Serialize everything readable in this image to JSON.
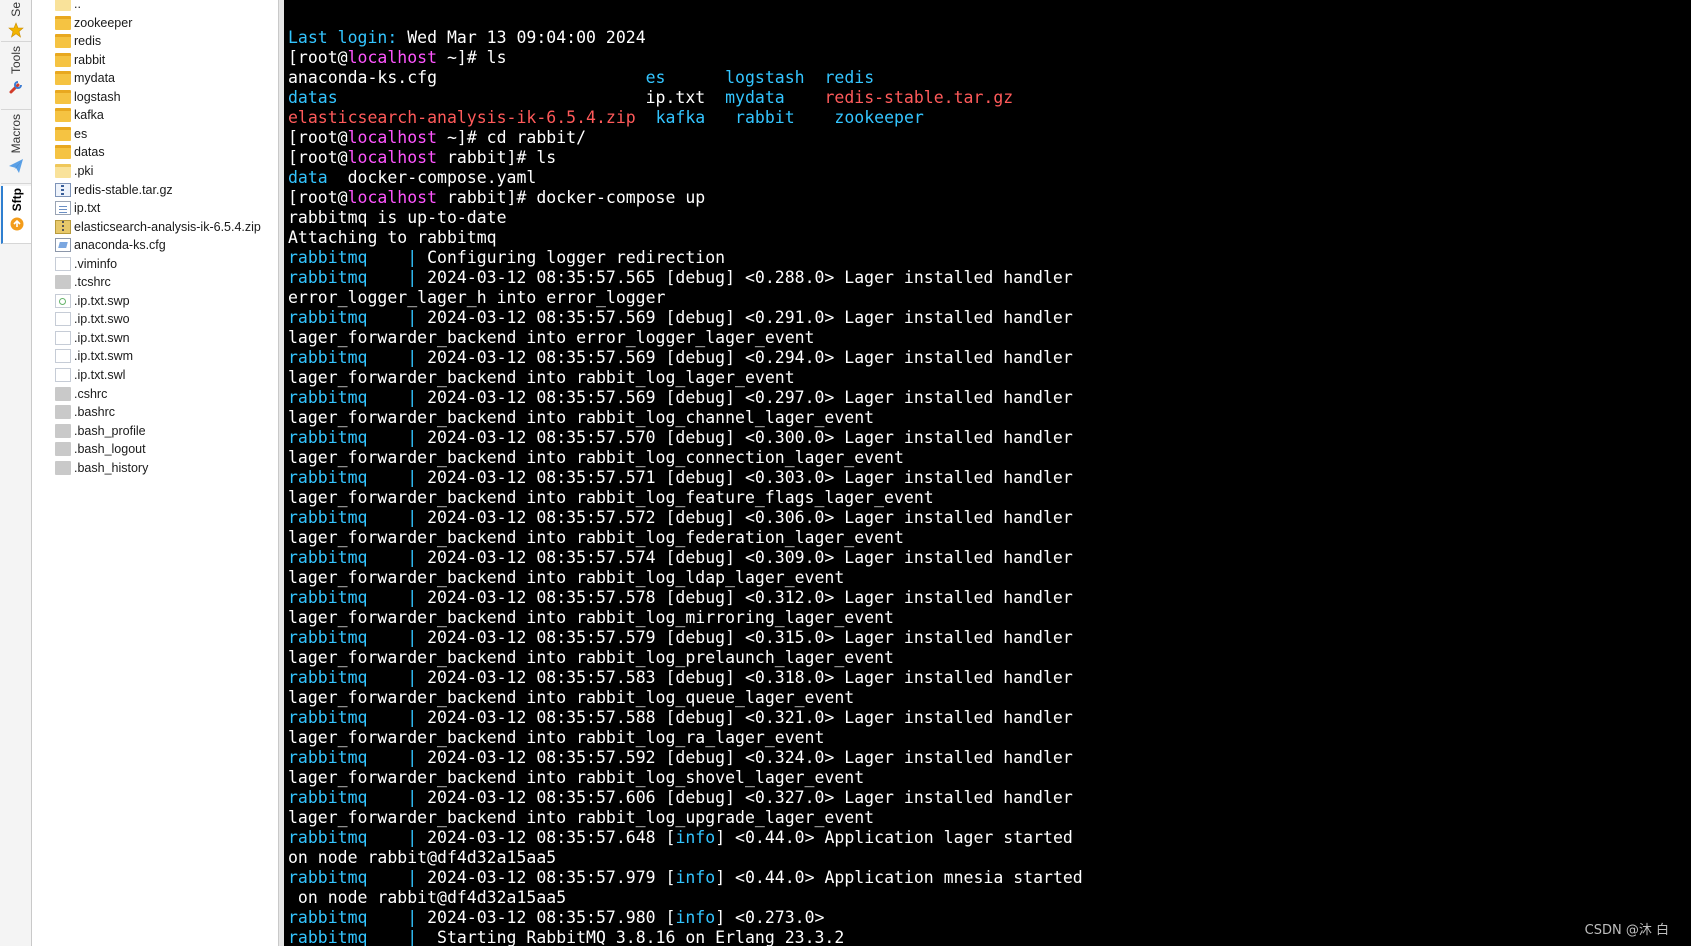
{
  "colors": {
    "prompt_host": "#ff55ff",
    "service": "#33c5ff",
    "folder": "#33c5ff",
    "info": "#33c5ff",
    "archive": "#ff5a5a",
    "text": "#ffffff",
    "background": "#000000"
  },
  "side_tabs": [
    {
      "label": "Se",
      "icon": "star-icon",
      "active": false
    },
    {
      "label": "Tools",
      "icon": "tools-icon",
      "active": false
    },
    {
      "label": "Macros",
      "icon": "macros-icon",
      "active": false
    },
    {
      "label": "Sftp",
      "icon": "sftp-icon",
      "active": true
    }
  ],
  "files": [
    {
      "name": "..",
      "icon": "parent-folder-icon"
    },
    {
      "name": "zookeeper",
      "icon": "folder-icon"
    },
    {
      "name": "redis",
      "icon": "folder-icon"
    },
    {
      "name": "rabbit",
      "icon": "folder-icon"
    },
    {
      "name": "mydata",
      "icon": "folder-icon"
    },
    {
      "name": "logstash",
      "icon": "folder-icon"
    },
    {
      "name": "kafka",
      "icon": "folder-icon"
    },
    {
      "name": "es",
      "icon": "folder-icon"
    },
    {
      "name": "datas",
      "icon": "folder-icon"
    },
    {
      "name": ".pki",
      "icon": "hidden-folder-icon"
    },
    {
      "name": "redis-stable.tar.gz",
      "icon": "archive-file-icon"
    },
    {
      "name": "ip.txt",
      "icon": "text-file-icon"
    },
    {
      "name": "elasticsearch-analysis-ik-6.5.4.zip",
      "icon": "zip-file-icon"
    },
    {
      "name": "anaconda-ks.cfg",
      "icon": "config-file-icon"
    },
    {
      "name": ".viminfo",
      "icon": "file-icon"
    },
    {
      "name": ".tcshrc",
      "icon": "hidden-file-icon"
    },
    {
      "name": ".ip.txt.swp",
      "icon": "swap-file-icon"
    },
    {
      "name": ".ip.txt.swo",
      "icon": "file-icon"
    },
    {
      "name": ".ip.txt.swn",
      "icon": "file-icon"
    },
    {
      "name": ".ip.txt.swm",
      "icon": "file-icon"
    },
    {
      "name": ".ip.txt.swl",
      "icon": "file-icon"
    },
    {
      "name": ".cshrc",
      "icon": "hidden-file-icon"
    },
    {
      "name": ".bashrc",
      "icon": "hidden-file-icon"
    },
    {
      "name": ".bash_profile",
      "icon": "hidden-file-icon"
    },
    {
      "name": ".bash_logout",
      "icon": "hidden-file-icon"
    },
    {
      "name": ".bash_history",
      "icon": "hidden-file-icon"
    }
  ],
  "terminal": {
    "lines": [
      [
        {
          "t": "Last login:",
          "c": "service"
        },
        {
          "t": " Wed Mar 13 09:04:00 2024"
        }
      ],
      [
        {
          "t": "[root@"
        },
        {
          "t": "localhost",
          "c": "prompt_host"
        },
        {
          "t": " ~]# ls"
        }
      ],
      [
        {
          "t": "anaconda-ks.cfg                     "
        },
        {
          "t": "es",
          "c": "folder"
        },
        {
          "t": "      "
        },
        {
          "t": "logstash",
          "c": "folder"
        },
        {
          "t": "  "
        },
        {
          "t": "redis",
          "c": "folder"
        }
      ],
      [
        {
          "t": "datas",
          "c": "folder"
        },
        {
          "t": "                               ip.txt  "
        },
        {
          "t": "mydata",
          "c": "folder"
        },
        {
          "t": "    "
        },
        {
          "t": "redis-stable.tar.gz",
          "c": "archive"
        }
      ],
      [
        {
          "t": "elasticsearch-analysis-ik-6.5.4.zip",
          "c": "archive"
        },
        {
          "t": "  "
        },
        {
          "t": "kafka",
          "c": "folder"
        },
        {
          "t": "   "
        },
        {
          "t": "rabbit",
          "c": "folder"
        },
        {
          "t": "    "
        },
        {
          "t": "zookeeper",
          "c": "folder"
        }
      ],
      [
        {
          "t": "[root@"
        },
        {
          "t": "localhost",
          "c": "prompt_host"
        },
        {
          "t": " ~]# cd rabbit/"
        }
      ],
      [
        {
          "t": "[root@"
        },
        {
          "t": "localhost",
          "c": "prompt_host"
        },
        {
          "t": " rabbit]# ls"
        }
      ],
      [
        {
          "t": "data",
          "c": "folder"
        },
        {
          "t": "  docker-compose.yaml"
        }
      ],
      [
        {
          "t": "[root@"
        },
        {
          "t": "localhost",
          "c": "prompt_host"
        },
        {
          "t": " rabbit]# docker-compose up"
        }
      ],
      [
        {
          "t": "rabbitmq is up-to-date"
        }
      ],
      [
        {
          "t": "Attaching to rabbitmq"
        }
      ],
      [
        {
          "t": "rabbitmq    | ",
          "c": "service"
        },
        {
          "t": "Configuring logger redirection"
        }
      ],
      [
        {
          "t": "rabbitmq    | ",
          "c": "service"
        },
        {
          "t": "2024-03-12 08:35:57.565 [debug] <0.288.0> Lager installed handler"
        }
      ],
      [
        {
          "t": "error_logger_lager_h into error_logger"
        }
      ],
      [
        {
          "t": "rabbitmq    | ",
          "c": "service"
        },
        {
          "t": "2024-03-12 08:35:57.569 [debug] <0.291.0> Lager installed handler"
        }
      ],
      [
        {
          "t": "lager_forwarder_backend into error_logger_lager_event"
        }
      ],
      [
        {
          "t": "rabbitmq    | ",
          "c": "service"
        },
        {
          "t": "2024-03-12 08:35:57.569 [debug] <0.294.0> Lager installed handler"
        }
      ],
      [
        {
          "t": "lager_forwarder_backend into rabbit_log_lager_event"
        }
      ],
      [
        {
          "t": "rabbitmq    | ",
          "c": "service"
        },
        {
          "t": "2024-03-12 08:35:57.569 [debug] <0.297.0> Lager installed handler"
        }
      ],
      [
        {
          "t": "lager_forwarder_backend into rabbit_log_channel_lager_event"
        }
      ],
      [
        {
          "t": "rabbitmq    | ",
          "c": "service"
        },
        {
          "t": "2024-03-12 08:35:57.570 [debug] <0.300.0> Lager installed handler"
        }
      ],
      [
        {
          "t": "lager_forwarder_backend into rabbit_log_connection_lager_event"
        }
      ],
      [
        {
          "t": "rabbitmq    | ",
          "c": "service"
        },
        {
          "t": "2024-03-12 08:35:57.571 [debug] <0.303.0> Lager installed handler"
        }
      ],
      [
        {
          "t": "lager_forwarder_backend into rabbit_log_feature_flags_lager_event"
        }
      ],
      [
        {
          "t": "rabbitmq    | ",
          "c": "service"
        },
        {
          "t": "2024-03-12 08:35:57.572 [debug] <0.306.0> Lager installed handler"
        }
      ],
      [
        {
          "t": "lager_forwarder_backend into rabbit_log_federation_lager_event"
        }
      ],
      [
        {
          "t": "rabbitmq    | ",
          "c": "service"
        },
        {
          "t": "2024-03-12 08:35:57.574 [debug] <0.309.0> Lager installed handler"
        }
      ],
      [
        {
          "t": "lager_forwarder_backend into rabbit_log_ldap_lager_event"
        }
      ],
      [
        {
          "t": "rabbitmq    | ",
          "c": "service"
        },
        {
          "t": "2024-03-12 08:35:57.578 [debug] <0.312.0> Lager installed handler"
        }
      ],
      [
        {
          "t": "lager_forwarder_backend into rabbit_log_mirroring_lager_event"
        }
      ],
      [
        {
          "t": "rabbitmq    | ",
          "c": "service"
        },
        {
          "t": "2024-03-12 08:35:57.579 [debug] <0.315.0> Lager installed handler"
        }
      ],
      [
        {
          "t": "lager_forwarder_backend into rabbit_log_prelaunch_lager_event"
        }
      ],
      [
        {
          "t": "rabbitmq    | ",
          "c": "service"
        },
        {
          "t": "2024-03-12 08:35:57.583 [debug] <0.318.0> Lager installed handler"
        }
      ],
      [
        {
          "t": "lager_forwarder_backend into rabbit_log_queue_lager_event"
        }
      ],
      [
        {
          "t": "rabbitmq    | ",
          "c": "service"
        },
        {
          "t": "2024-03-12 08:35:57.588 [debug] <0.321.0> Lager installed handler"
        }
      ],
      [
        {
          "t": "lager_forwarder_backend into rabbit_log_ra_lager_event"
        }
      ],
      [
        {
          "t": "rabbitmq    | ",
          "c": "service"
        },
        {
          "t": "2024-03-12 08:35:57.592 [debug] <0.324.0> Lager installed handler"
        }
      ],
      [
        {
          "t": "lager_forwarder_backend into rabbit_log_shovel_lager_event"
        }
      ],
      [
        {
          "t": "rabbitmq    | ",
          "c": "service"
        },
        {
          "t": "2024-03-12 08:35:57.606 [debug] <0.327.0> Lager installed handler"
        }
      ],
      [
        {
          "t": "lager_forwarder_backend into rabbit_log_upgrade_lager_event"
        }
      ],
      [
        {
          "t": "rabbitmq    | ",
          "c": "service"
        },
        {
          "t": "2024-03-12 08:35:57.648 ["
        },
        {
          "t": "info",
          "c": "info"
        },
        {
          "t": "] <0.44.0> Application lager started"
        }
      ],
      [
        {
          "t": "on node rabbit@df4d32a15aa5"
        }
      ],
      [
        {
          "t": "rabbitmq    | ",
          "c": "service"
        },
        {
          "t": "2024-03-12 08:35:57.979 ["
        },
        {
          "t": "info",
          "c": "info"
        },
        {
          "t": "] <0.44.0> Application mnesia started"
        }
      ],
      [
        {
          "t": " on node rabbit@df4d32a15aa5"
        }
      ],
      [
        {
          "t": "rabbitmq    | ",
          "c": "service"
        },
        {
          "t": "2024-03-12 08:35:57.980 ["
        },
        {
          "t": "info",
          "c": "info"
        },
        {
          "t": "] <0.273.0>"
        }
      ],
      [
        {
          "t": "rabbitmq    |  ",
          "c": "service"
        },
        {
          "t": "Starting RabbitMQ 3.8.16 on Erlang 23.3.2"
        }
      ]
    ]
  },
  "watermark": "CSDN @沐    白"
}
